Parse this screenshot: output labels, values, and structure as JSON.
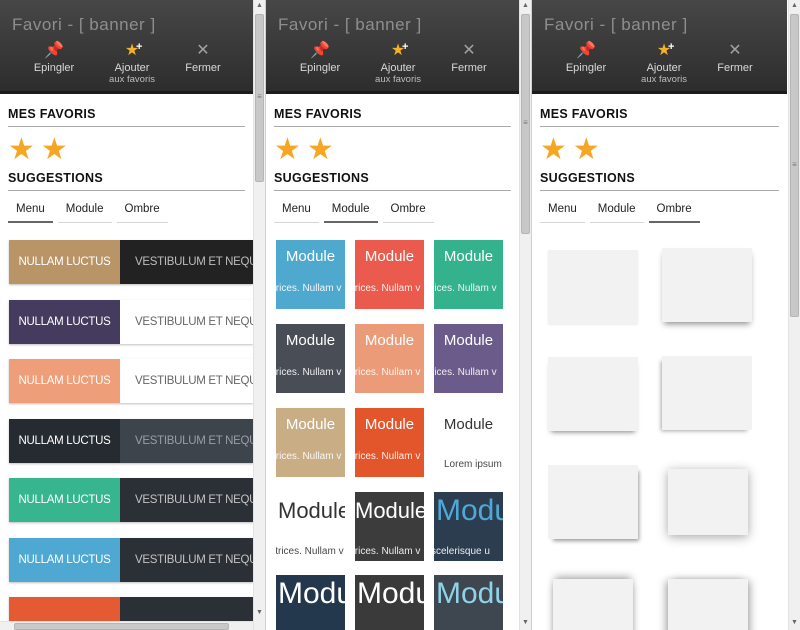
{
  "window": {
    "title": "Favori - [ banner ]",
    "toolbar": {
      "pin": {
        "label": "Epingler",
        "icon": "pin-icon"
      },
      "add": {
        "label": "Ajouter",
        "sub": "aux favoris",
        "icon": "star-plus-icon"
      },
      "close": {
        "label": "Fermer",
        "icon": "close-icon"
      }
    }
  },
  "favorites": {
    "title": "MES FAVORIS",
    "star_count": 2
  },
  "suggestions": {
    "title": "SUGGESTIONS",
    "tabs": [
      "Menu",
      "Module",
      "Ombre"
    ]
  },
  "menu_items": [
    {
      "left": "NULLAM LUCTUS",
      "right": "VESTIBULUM ET NEQUE",
      "left_color": "#b89467",
      "right_color": "#222222",
      "right_text_color": "#bdbdbd"
    },
    {
      "left": "NULLAM LUCTUS",
      "right": "VESTIBULUM ET NEQUE",
      "left_color": "#443b5e",
      "right_color": "#ffffff",
      "right_text_color": "#666666"
    },
    {
      "left": "NULLAM LUCTUS",
      "right": "VESTIBULUM ET NEQUE",
      "left_color": "#ee9e78",
      "right_color": "#ffffff",
      "right_text_color": "#666666"
    },
    {
      "left": "NULLAM LUCTUS",
      "right": "VESTIBULUM ET NEQUE",
      "left_color": "#262b31",
      "right_color": "#3e444c",
      "right_text_color": "#9a9ea3"
    },
    {
      "left": "NULLAM LUCTUS",
      "right": "VESTIBULUM ET NEQUE",
      "left_color": "#36b58f",
      "right_color": "#2b2f36",
      "right_text_color": "#c3c3c3"
    },
    {
      "left": "NULLAM LUCTUS",
      "right": "VESTIBULUM ET NEQUE",
      "left_color": "#4ea8d2",
      "right_color": "#2b2f36",
      "right_text_color": "#c3c3c3"
    },
    {
      "left": "",
      "right": "",
      "left_color": "#e35a33",
      "right_color": "#2b2f36",
      "right_text_color": "#c3c3c3"
    }
  ],
  "modules": [
    {
      "title": "Module",
      "sub": "trices. Nullam v",
      "bg": "#4fa9cf",
      "fg": "#ffffff",
      "size": "normal"
    },
    {
      "title": "Module",
      "sub": "trices. Nullam v",
      "bg": "#ea5a4d",
      "fg": "#ffffff",
      "size": "normal"
    },
    {
      "title": "Module",
      "sub": "rices. Nullam v",
      "bg": "#34b18d",
      "fg": "#ffffff",
      "size": "normal"
    },
    {
      "title": "Module",
      "sub": "trices. Nullam v",
      "bg": "#484d56",
      "fg": "#ffffff",
      "size": "normal"
    },
    {
      "title": "Module",
      "sub": "trices. Nullam v",
      "bg": "#ec9b78",
      "fg": "#ffffff",
      "size": "normal"
    },
    {
      "title": "Module",
      "sub": "rices. Nullam v",
      "bg": "#6a5b8a",
      "fg": "#ffffff",
      "size": "normal"
    },
    {
      "title": "Module",
      "sub": "trices. Nullam v",
      "bg": "#c9ad85",
      "fg": "#ffffff",
      "size": "normal"
    },
    {
      "title": "Module",
      "sub": "trices. Nullam v",
      "bg": "#e3562c",
      "fg": "#ffffff",
      "size": "normal"
    },
    {
      "title": "Module",
      "sub": "Lorem ipsum",
      "bg": "#ffffff",
      "fg": "#333333",
      "size": "normal"
    },
    {
      "title": "Module",
      "sub": "ltrices. Nullam v",
      "bg": "#ffffff",
      "fg": "#333333",
      "size": "big"
    },
    {
      "title": "Module",
      "sub": "trices. Nullam v",
      "bg": "#3c3c3c",
      "fg": "#ffffff",
      "size": "big"
    },
    {
      "title": "Modu",
      "sub": "scelerisque u",
      "bg": "#2b3d4f",
      "fg": "#4fa9d8",
      "size": "huge"
    },
    {
      "title": "Modu",
      "sub": "",
      "bg": "#23384c",
      "fg": "#ffffff",
      "size": "huge"
    },
    {
      "title": "Module",
      "sub": "",
      "bg": "#3a3a3a",
      "fg": "#ffffff",
      "size": "huge"
    },
    {
      "title": "Modu",
      "sub": "",
      "bg": "#3e4650",
      "fg": "#8fd3e8",
      "size": "huge"
    }
  ],
  "shadow_cards": 8
}
